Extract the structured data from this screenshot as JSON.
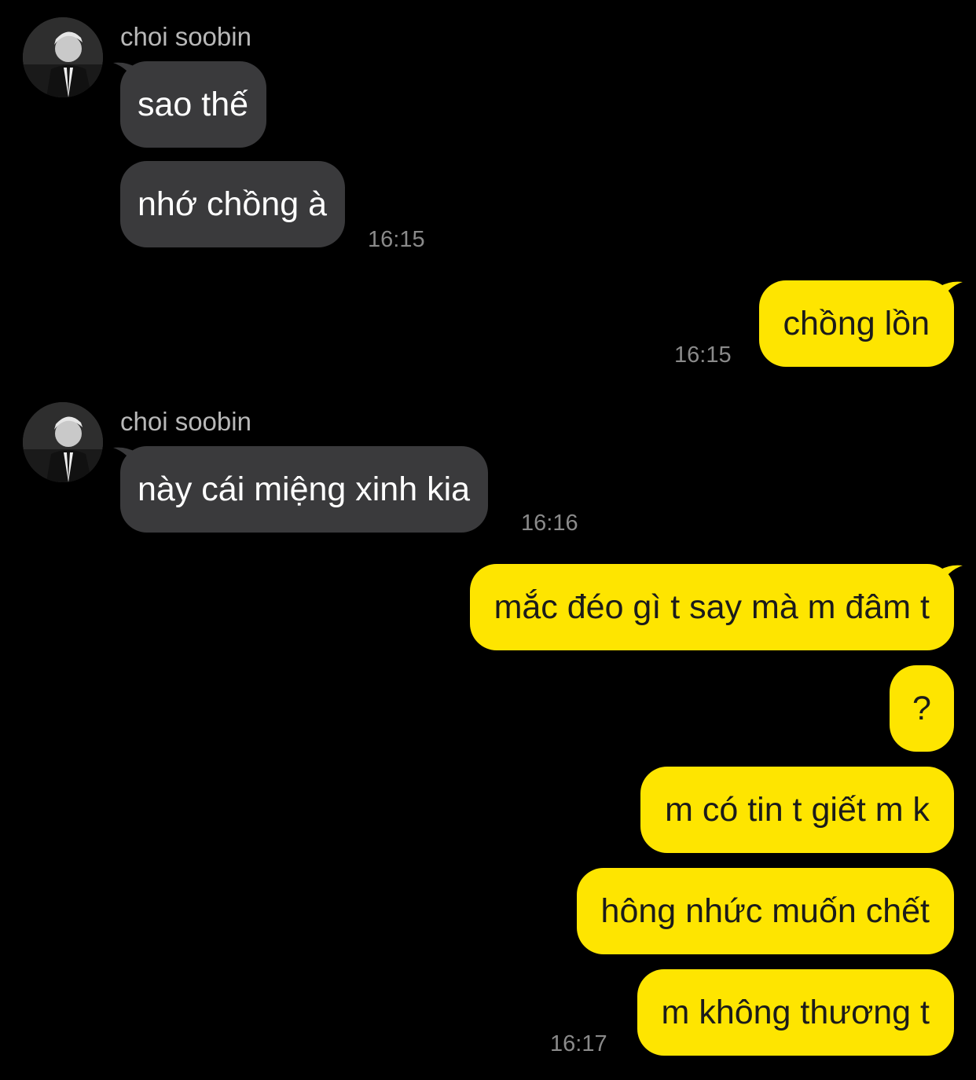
{
  "colors": {
    "background": "#000000",
    "incoming_bubble": "#3a3a3c",
    "outgoing_bubble": "#fee500",
    "timestamp": "#8a8a8a"
  },
  "groups": [
    {
      "sender": "choi soobin",
      "avatar": "profile-photo",
      "messages": [
        "sao thế",
        "nhớ chồng à"
      ],
      "time": "16:15"
    },
    {
      "direction": "outgoing",
      "messages": [
        "chồng lồn"
      ],
      "time": "16:15"
    },
    {
      "sender": "choi soobin",
      "avatar": "profile-photo",
      "messages": [
        "này cái miệng xinh kia"
      ],
      "time": "16:16"
    },
    {
      "direction": "outgoing",
      "messages": [
        "mắc đéo gì t say mà m đâm t",
        "?",
        "m có tin t giết m k",
        "hông nhức muốn chết",
        "m không thương t"
      ],
      "time": "16:17"
    }
  ]
}
